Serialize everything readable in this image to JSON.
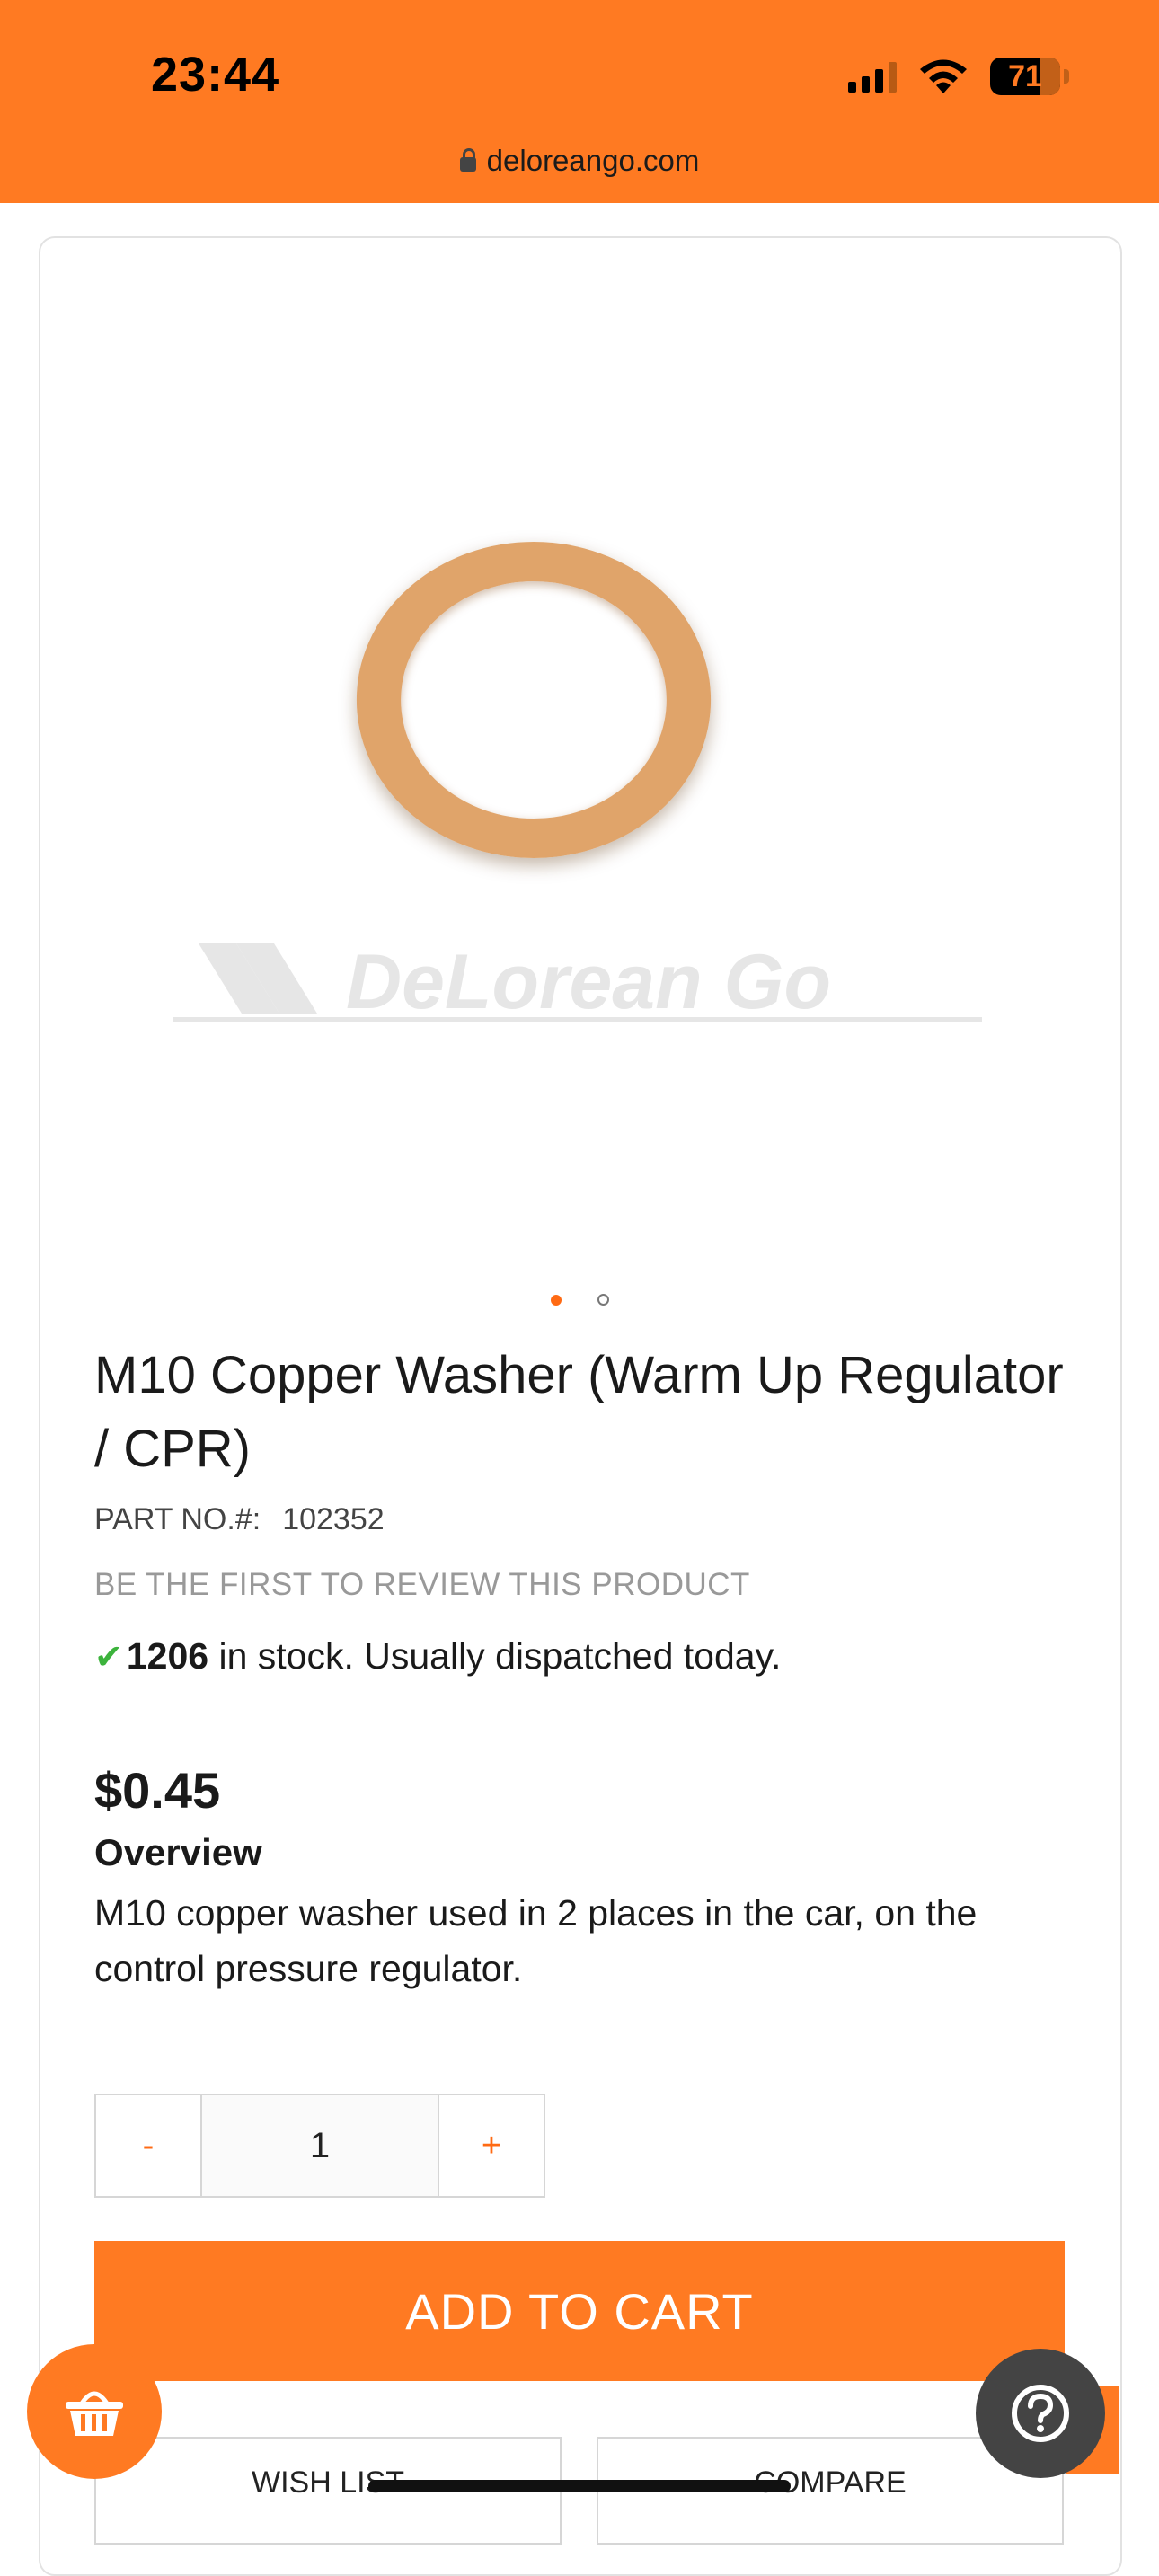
{
  "status_bar": {
    "time": "23:44",
    "battery": "71"
  },
  "browser": {
    "url": "deloreango.com"
  },
  "product_image": {
    "watermark": "DeLorean Go",
    "carousel": {
      "count": 2,
      "active": 0
    }
  },
  "product": {
    "title": "M10 Copper Washer (Warm Up Regulator / CPR)",
    "part_label": "PART NO.#:",
    "part_number": "102352",
    "review_link": "BE THE FIRST TO REVIEW THIS PRODUCT",
    "stock_count": "1206",
    "stock_text": "in stock. Usually dispatched today.",
    "price": "$0.45",
    "overview_heading": "Overview",
    "overview_text": "M10 copper washer used in 2 places in the car, on the control pressure regulator."
  },
  "quantity": {
    "minus": "-",
    "value": "1",
    "plus": "+"
  },
  "actions": {
    "add_to_cart": "ADD TO CART",
    "wish_list": "WISH LIST",
    "compare": "COMPARE"
  },
  "colors": {
    "accent": "#ff7a22",
    "stock_check": "#3cb33c",
    "help_bg": "#444444"
  },
  "icons": {
    "basket": "basket-icon",
    "help": "question-icon",
    "lock": "lock-icon"
  }
}
